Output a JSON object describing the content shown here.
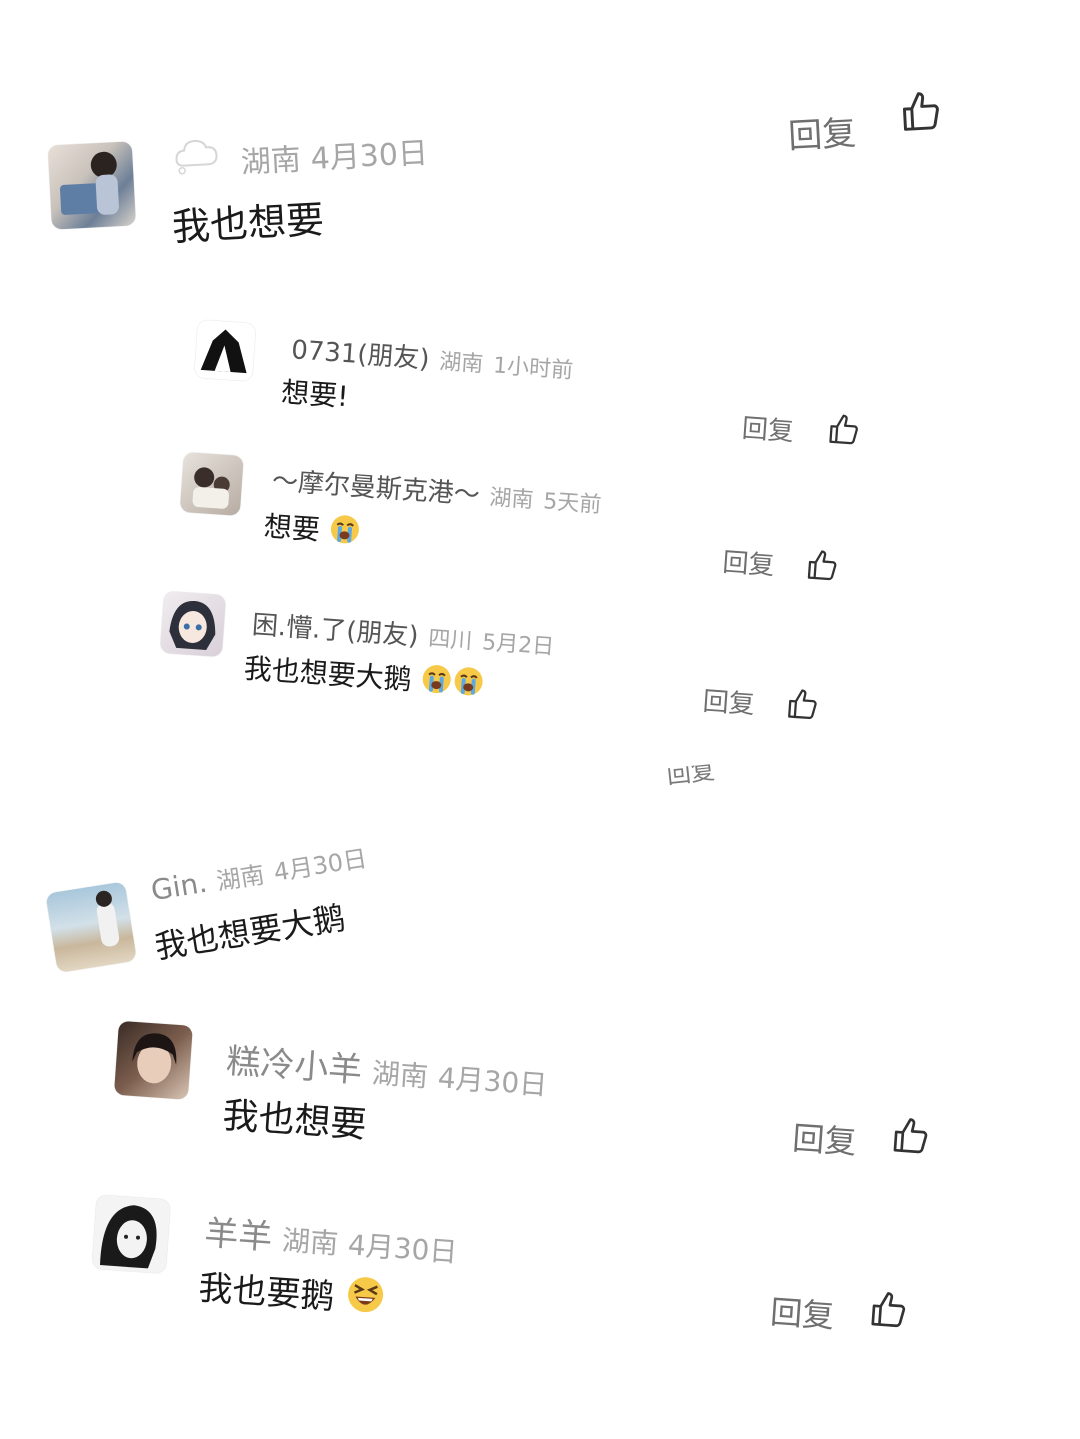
{
  "comments": [
    {
      "name": "",
      "location": "湖南",
      "date": "4月30日",
      "text": "我也想要",
      "reply_label": "回复",
      "avatar": "girl-with-bag-avatar"
    },
    {
      "name": "0731(朋友)",
      "location": "湖南",
      "date": "1小时前",
      "text": "想要!",
      "reply_label": "回复",
      "avatar": "black-white-figure-avatar"
    },
    {
      "name": "～摩尔曼斯克港～",
      "location": "湖南",
      "date": "5天前",
      "text": "想要",
      "reply_label": "回复",
      "emoji": "loudly-crying-emoji",
      "avatar": "children-photo-avatar"
    },
    {
      "name": "困.懵.了(朋友)",
      "location": "四川",
      "date": "5月2日",
      "text": "我也想要大鹅",
      "reply_label": "回复",
      "emoji": "loudly-crying-emoji",
      "avatar": "anime-girl-avatar"
    },
    {
      "name": "Gin.",
      "location": "湖南",
      "date": "4月30日",
      "text": "我也想要大鹅",
      "avatar": "beach-photo-avatar"
    },
    {
      "name": "糕冷小羊",
      "location": "湖南",
      "date": "4月30日",
      "text": "我也想要",
      "reply_label": "回复",
      "avatar": "girl-selfie-avatar"
    },
    {
      "name": "羊羊",
      "location": "湖南",
      "date": "4月30日",
      "text": "我也要鹅",
      "reply_label": "回复",
      "emoji": "laughing-squint-emoji",
      "avatar": "sketch-girl-avatar"
    }
  ],
  "cut_fragment": "回复",
  "colors": {
    "text": "#1a1a1a",
    "meta": "#a6a6a6",
    "name": "#8a8a8a",
    "reply": "#6f6f6f"
  }
}
